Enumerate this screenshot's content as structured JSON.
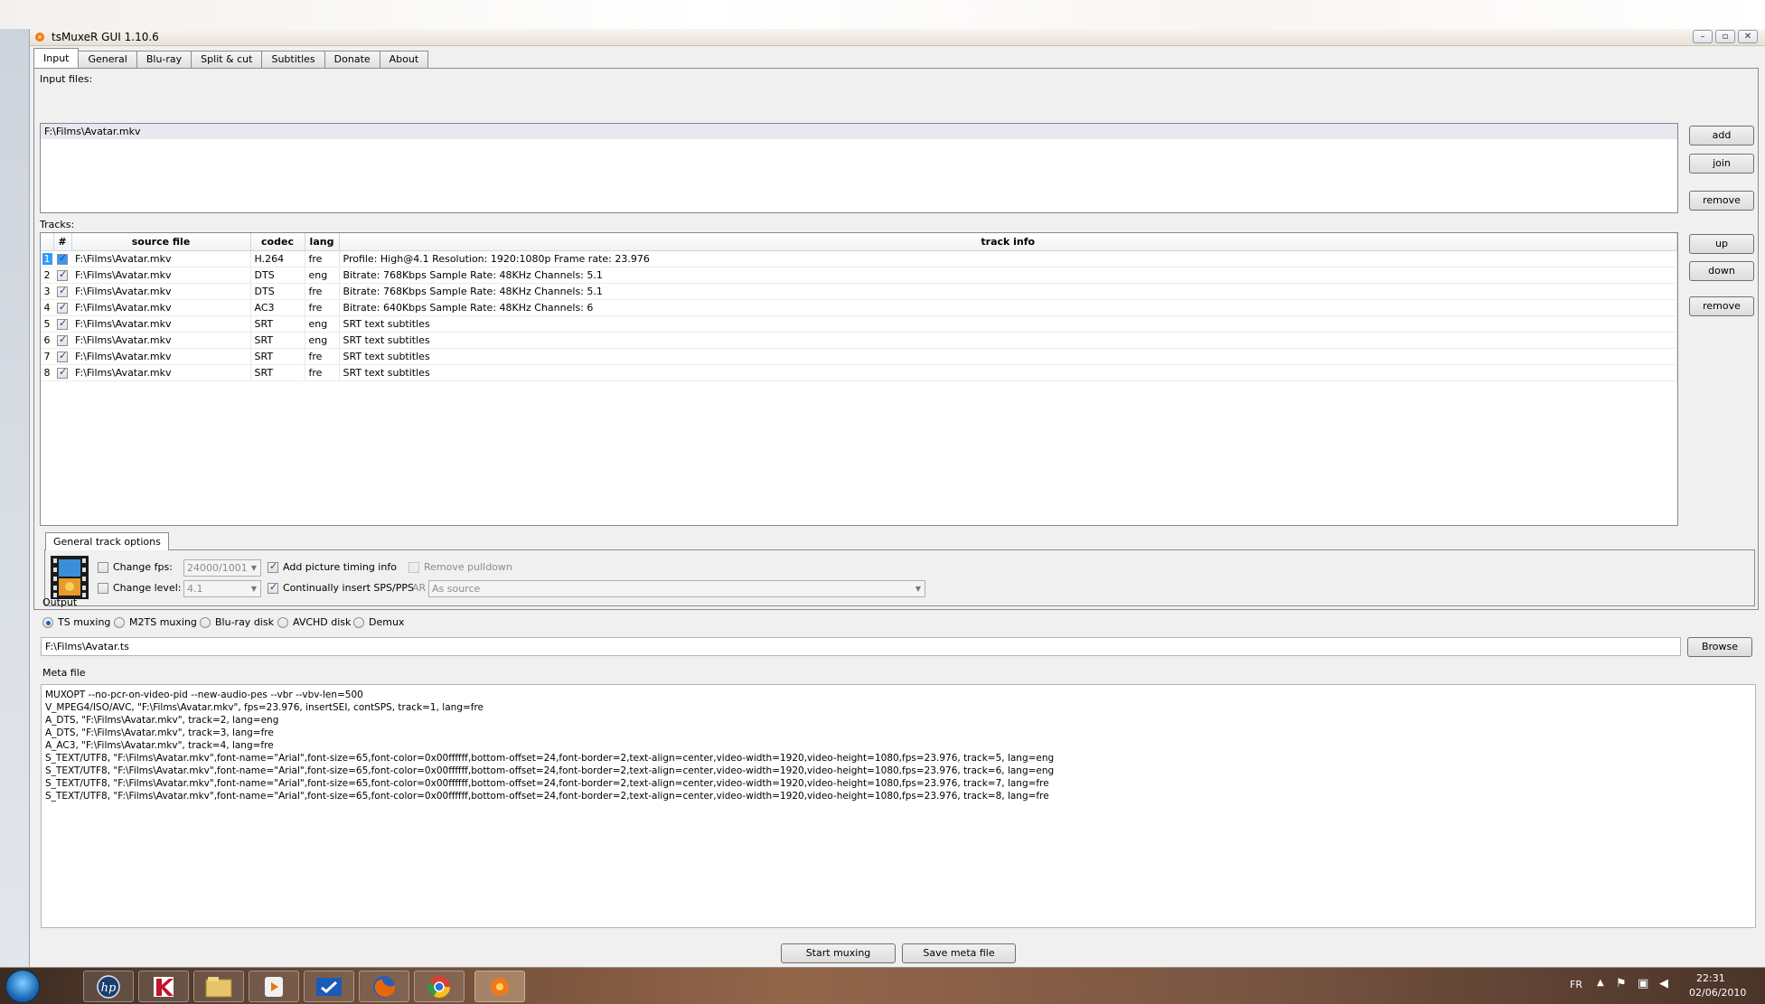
{
  "window": {
    "title": "tsMuxeR GUI 1.10.6",
    "controls": [
      "–",
      "▫",
      "✕"
    ]
  },
  "tabs": [
    "Input",
    "General",
    "Blu-ray",
    "Split & cut",
    "Subtitles",
    "Donate",
    "About"
  ],
  "input": {
    "input_files_label": "Input files:",
    "files": [
      "F:\\Films\\Avatar.mkv"
    ],
    "buttons": {
      "add": "add",
      "join": "join",
      "remove": "remove"
    },
    "tracks_label": "Tracks:",
    "track_buttons": {
      "up": "up",
      "down": "down",
      "remove": "remove"
    },
    "columns": [
      "#",
      "source file",
      "codec",
      "lang",
      "track info"
    ],
    "tracks": [
      {
        "n": "1",
        "file": "F:\\Films\\Avatar.mkv",
        "codec": "H.264",
        "lang": "fre",
        "info": "Profile: High@4.1  Resolution: 1920:1080p  Frame rate: 23.976"
      },
      {
        "n": "2",
        "file": "F:\\Films\\Avatar.mkv",
        "codec": "DTS",
        "lang": "eng",
        "info": "Bitrate: 768Kbps  Sample Rate: 48KHz  Channels: 5.1"
      },
      {
        "n": "3",
        "file": "F:\\Films\\Avatar.mkv",
        "codec": "DTS",
        "lang": "fre",
        "info": "Bitrate: 768Kbps  Sample Rate: 48KHz  Channels: 5.1"
      },
      {
        "n": "4",
        "file": "F:\\Films\\Avatar.mkv",
        "codec": "AC3",
        "lang": "fre",
        "info": "Bitrate: 640Kbps Sample Rate: 48KHz Channels: 6"
      },
      {
        "n": "5",
        "file": "F:\\Films\\Avatar.mkv",
        "codec": "SRT",
        "lang": "eng",
        "info": "SRT text subtitles"
      },
      {
        "n": "6",
        "file": "F:\\Films\\Avatar.mkv",
        "codec": "SRT",
        "lang": "eng",
        "info": "SRT text subtitles"
      },
      {
        "n": "7",
        "file": "F:\\Films\\Avatar.mkv",
        "codec": "SRT",
        "lang": "fre",
        "info": "SRT text subtitles"
      },
      {
        "n": "8",
        "file": "F:\\Films\\Avatar.mkv",
        "codec": "SRT",
        "lang": "fre",
        "info": "SRT text subtitles"
      }
    ],
    "general_track_options": {
      "tab_label": "General track options",
      "change_fps": "Change fps:",
      "fps_value": "24000/1001",
      "change_level": "Change level:",
      "level_value": "4.1",
      "add_picture_timing": "Add picture timing info",
      "continually_insert": "Continually insert SPS/PPS",
      "remove_pulldown": "Remove pulldown",
      "ar_label": "AR",
      "ar_value": "As source"
    }
  },
  "output": {
    "title": "Output",
    "modes": [
      "TS muxing",
      "M2TS muxing",
      "Blu-ray disk",
      "AVCHD disk",
      "Demux"
    ],
    "selected_mode": "TS muxing",
    "path": "F:\\Films\\Avatar.ts",
    "browse": "Browse"
  },
  "meta": {
    "title": "Meta file",
    "lines": [
      "MUXOPT --no-pcr-on-video-pid --new-audio-pes --vbr  --vbv-len=500",
      "V_MPEG4/ISO/AVC, \"F:\\Films\\Avatar.mkv\", fps=23.976, insertSEI, contSPS, track=1, lang=fre",
      "A_DTS, \"F:\\Films\\Avatar.mkv\", track=2, lang=eng",
      "A_DTS, \"F:\\Films\\Avatar.mkv\", track=3, lang=fre",
      "A_AC3, \"F:\\Films\\Avatar.mkv\", track=4, lang=fre",
      "S_TEXT/UTF8, \"F:\\Films\\Avatar.mkv\",font-name=\"Arial\",font-size=65,font-color=0x00ffffff,bottom-offset=24,font-border=2,text-align=center,video-width=1920,video-height=1080,fps=23.976, track=5, lang=eng",
      "S_TEXT/UTF8, \"F:\\Films\\Avatar.mkv\",font-name=\"Arial\",font-size=65,font-color=0x00ffffff,bottom-offset=24,font-border=2,text-align=center,video-width=1920,video-height=1080,fps=23.976, track=6, lang=eng",
      "S_TEXT/UTF8, \"F:\\Films\\Avatar.mkv\",font-name=\"Arial\",font-size=65,font-color=0x00ffffff,bottom-offset=24,font-border=2,text-align=center,video-width=1920,video-height=1080,fps=23.976, track=7, lang=fre",
      "S_TEXT/UTF8, \"F:\\Films\\Avatar.mkv\",font-name=\"Arial\",font-size=65,font-color=0x00ffffff,bottom-offset=24,font-border=2,text-align=center,video-width=1920,video-height=1080,fps=23.976, track=8, lang=fre"
    ]
  },
  "actions": {
    "start": "Start muxing",
    "save": "Save meta file"
  },
  "taskbar": {
    "apps": [
      "hp-icon",
      "kaspersky-icon",
      "file-explorer-icon",
      "media-player-icon",
      "checkmark-app-icon",
      "firefox-icon",
      "chrome-icon",
      "tsmuxer-icon"
    ],
    "lang": "FR",
    "time": "22:31",
    "date": "02/06/2010"
  },
  "colors": {
    "selection": "#3399ff",
    "window_bg": "#f0f0f0",
    "accent": "#1f5fc2"
  }
}
